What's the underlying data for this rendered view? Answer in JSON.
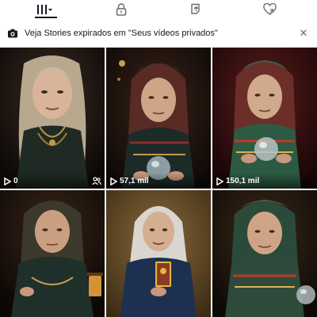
{
  "tabs": [
    {
      "icon": "grid-icon"
    },
    {
      "icon": "lock-icon"
    },
    {
      "icon": "repost-icon"
    },
    {
      "icon": "liked-heart-icon"
    }
  ],
  "banner": {
    "icon": "stories-camera-icon",
    "text": "Veja Stories expirados em \"Seus vídeos privados\"",
    "close_icon": "close-icon"
  },
  "videos": [
    {
      "views": "0",
      "badge": "lock-people-icon"
    },
    {
      "views": "57,1 mil"
    },
    {
      "views": "150,1 mil"
    },
    {
      "views": ""
    },
    {
      "views": ""
    },
    {
      "views": ""
    }
  ],
  "colors": {
    "text": "#161823",
    "muted": "#6b6b70",
    "background": "#ffffff"
  }
}
